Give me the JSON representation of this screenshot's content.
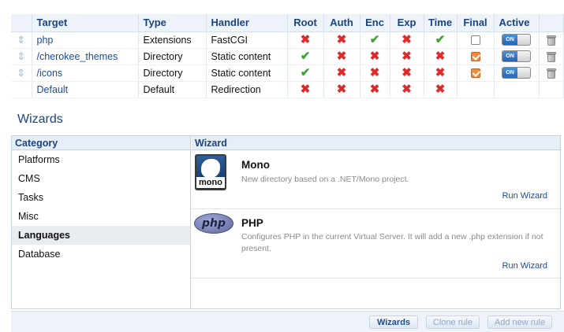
{
  "rules": {
    "columns": [
      "Target",
      "Type",
      "Handler",
      "Root",
      "Auth",
      "Enc",
      "Exp",
      "Time",
      "Final",
      "Active"
    ],
    "rows": [
      {
        "target": "php",
        "type": "Extensions",
        "handler": "FastCGI",
        "root": "no",
        "auth": "no",
        "enc": "yes",
        "exp": "no",
        "time": "yes",
        "final": false,
        "active": true,
        "toggle_label": "ON"
      },
      {
        "target": "/cherokee_themes",
        "type": "Directory",
        "handler": "Static content",
        "root": "yes",
        "auth": "no",
        "enc": "no",
        "exp": "no",
        "time": "no",
        "final": true,
        "active": true,
        "toggle_label": "ON"
      },
      {
        "target": "/icons",
        "type": "Directory",
        "handler": "Static content",
        "root": "yes",
        "auth": "no",
        "enc": "no",
        "exp": "no",
        "time": "no",
        "final": true,
        "active": true,
        "toggle_label": "ON"
      },
      {
        "target": "Default",
        "type": "Default",
        "handler": "Redirection",
        "root": "no",
        "auth": "no",
        "enc": "no",
        "exp": "no",
        "time": "no"
      }
    ]
  },
  "wizards": {
    "title": "Wizards",
    "category_header": "Category",
    "wizard_header": "Wizard",
    "categories": [
      "Platforms",
      "CMS",
      "Tasks",
      "Misc",
      "Languages",
      "Database"
    ],
    "active_category": "Languages",
    "items": [
      {
        "name": "Mono",
        "logo_text": "mono",
        "description": "New directory based on a .NET/Mono project.",
        "run": "Run Wizard"
      },
      {
        "name": "PHP",
        "logo_text": "php",
        "description": "Configures PHP in the current Virtual Server. It will add a new .php extension if not present.",
        "run": "Run Wizard"
      }
    ]
  },
  "buttons": {
    "wizards": "Wizards",
    "clone": "Clone rule",
    "add": "Add new rule"
  },
  "colors": {
    "header_blue": "#1a4480",
    "link_blue": "#1a4c9c",
    "cross_red": "#dd2b2b",
    "check_green": "#3ea535",
    "final_orange": "#f08a3c"
  }
}
